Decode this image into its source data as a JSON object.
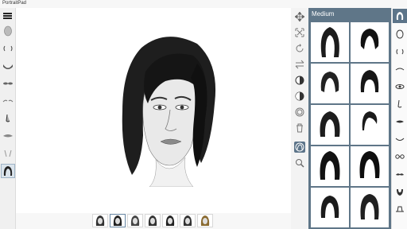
{
  "window": {
    "title": "PortraitPad"
  },
  "gallery": {
    "title": "Medium"
  },
  "left_toolbar": {
    "menu_icon": "hamburger-icon",
    "features": [
      "head-shape",
      "ears",
      "mouth",
      "eyes",
      "eyebrows",
      "nose",
      "lips",
      "lines",
      "hair"
    ],
    "active_feature": "hair"
  },
  "tools": [
    "move",
    "resize",
    "rotate",
    "flip",
    "contrast",
    "shading",
    "opacity",
    "delete",
    "hair-tool",
    "zoom"
  ],
  "categories": [
    "hair",
    "face-shape",
    "ears",
    "eyebrows",
    "eyes",
    "nose",
    "lips",
    "mouth",
    "glasses",
    "mustache",
    "beard",
    "accessories"
  ],
  "colors": {
    "panel": "#5f7688",
    "accent": "#5c7489"
  }
}
